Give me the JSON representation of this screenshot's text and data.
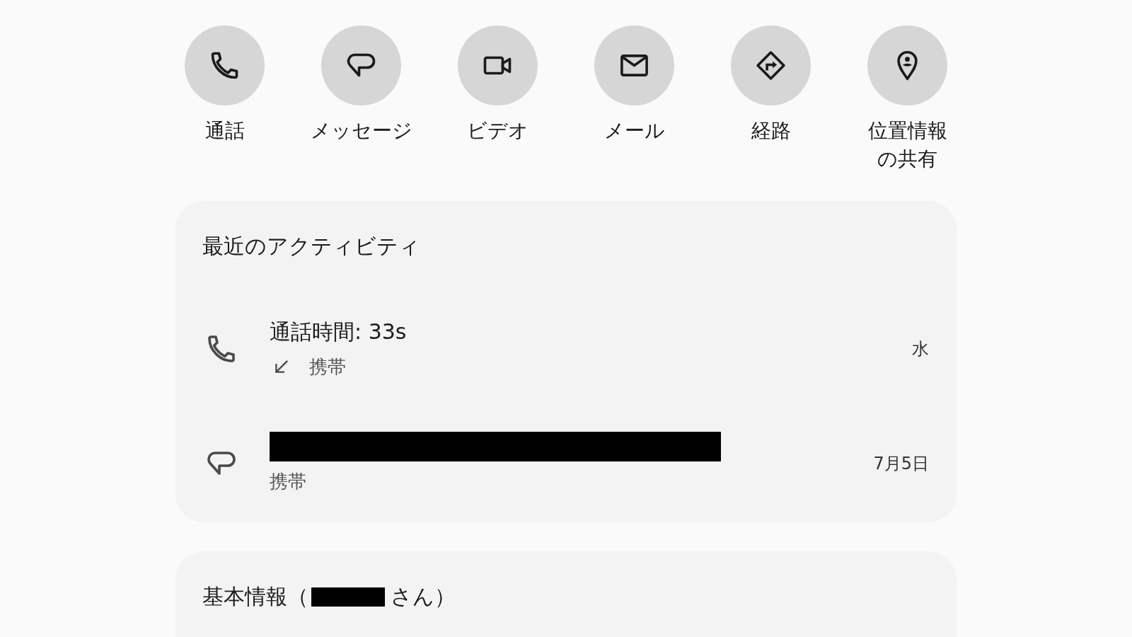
{
  "actions": [
    {
      "kind": "call",
      "label_lines": [
        "通話"
      ]
    },
    {
      "kind": "message",
      "label_lines": [
        "メッセージ"
      ]
    },
    {
      "kind": "video",
      "label_lines": [
        "ビデオ"
      ]
    },
    {
      "kind": "email",
      "label_lines": [
        "メール"
      ]
    },
    {
      "kind": "directions",
      "label_lines": [
        "経路"
      ]
    },
    {
      "kind": "location_share",
      "label_lines": [
        "位置情報",
        "の共有"
      ]
    }
  ],
  "activity": {
    "title": "最近のアクティビティ",
    "items": [
      {
        "kind": "call",
        "title": "通話時間: 33s",
        "redacted": false,
        "incoming": true,
        "detail": "携帯",
        "time": "水"
      },
      {
        "kind": "message",
        "redacted": true,
        "incoming": false,
        "detail": "携帯",
        "time": "7月5日"
      }
    ]
  },
  "info": {
    "title": "基本情報（",
    "name_redacted": true,
    "title_suffix": "さん）"
  }
}
